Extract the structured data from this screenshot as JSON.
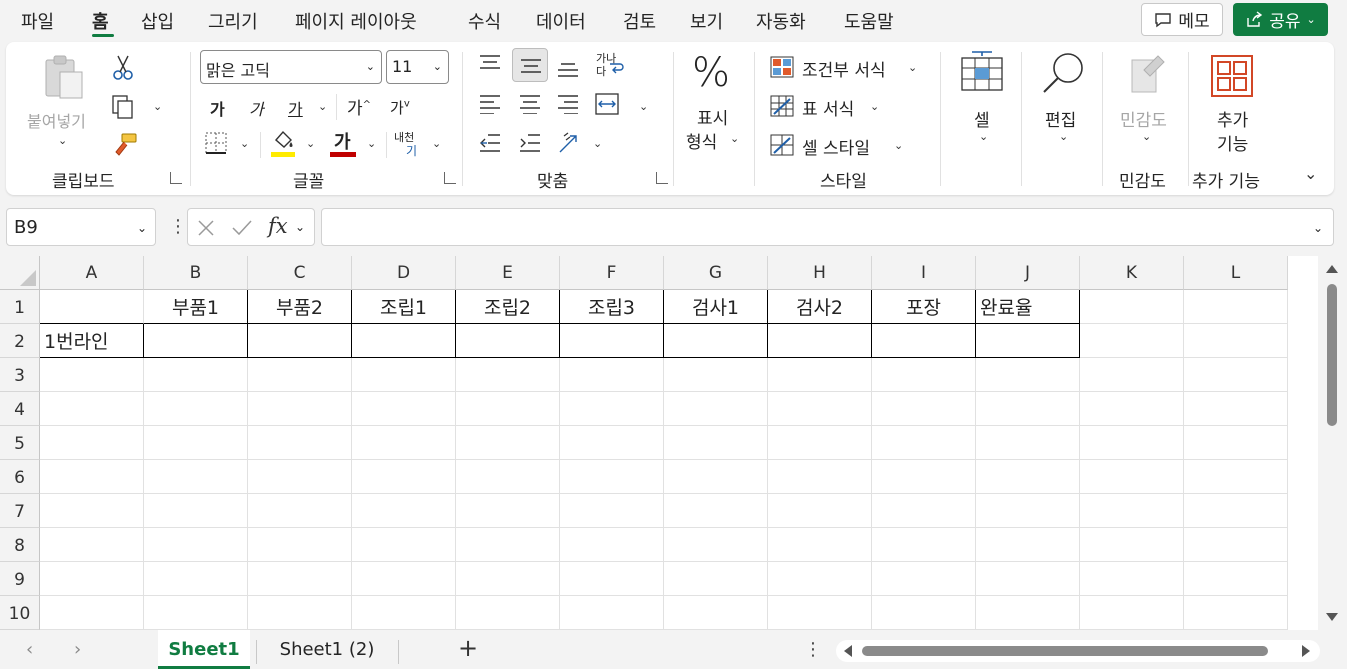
{
  "menu": {
    "items": [
      "파일",
      "홈",
      "삽입",
      "그리기",
      "페이지 레이아웃",
      "수식",
      "데이터",
      "검토",
      "보기",
      "자동화",
      "도움말"
    ],
    "active": "홈",
    "memo_label": "메모",
    "share_label": "공유"
  },
  "ribbon": {
    "clipboard": {
      "paste_label": "붙여넣기",
      "group_label": "클립보드"
    },
    "font": {
      "font_name": "맑은 고딕",
      "font_size": "11",
      "bold_glyph": "가",
      "italic_glyph": "가",
      "underline_glyph": "가",
      "grow_glyph": "가",
      "shrink_glyph": "가",
      "color_glyph": "가",
      "phonetic_top": "내천",
      "phonetic_bottom": "기",
      "group_label": "글꼴",
      "fill_color": "#ffeb00",
      "font_color": "#c00000"
    },
    "alignment": {
      "wrap_top": "가나",
      "wrap_bottom": "다",
      "group_label": "맞춤"
    },
    "number": {
      "symbol": "%",
      "label_line1": "표시",
      "label_line2": "형식"
    },
    "styles": {
      "conditional": "조건부 서식",
      "table": "표 서식",
      "cell_style": "셀 스타일",
      "group_label": "스타일"
    },
    "cells": {
      "label": "셀"
    },
    "editing": {
      "label": "편집"
    },
    "sensitivity": {
      "label": "민감도",
      "group_label": "민감도"
    },
    "addins": {
      "label_line1": "추가",
      "label_line2": "기능",
      "group_label": "추가 기능"
    }
  },
  "formula_bar": {
    "name_box": "B9",
    "fx": "fx",
    "formula": ""
  },
  "sheet": {
    "columns": [
      "A",
      "B",
      "C",
      "D",
      "E",
      "F",
      "G",
      "H",
      "I",
      "J",
      "K",
      "L"
    ],
    "rows": [
      "1",
      "2",
      "3",
      "4",
      "5",
      "6",
      "7",
      "8",
      "9",
      "10"
    ],
    "header_row": [
      "",
      "부품1",
      "부품2",
      "조립1",
      "조립2",
      "조립3",
      "검사1",
      "검사2",
      "포장",
      "완료율"
    ],
    "line_row": [
      "1번라인",
      "",
      "",
      "",
      "",
      "",
      "",
      "",
      "",
      ""
    ]
  },
  "tabs": {
    "sheets": [
      "Sheet1",
      "Sheet1 (2)"
    ],
    "active": "Sheet1",
    "add_glyph": "+"
  }
}
